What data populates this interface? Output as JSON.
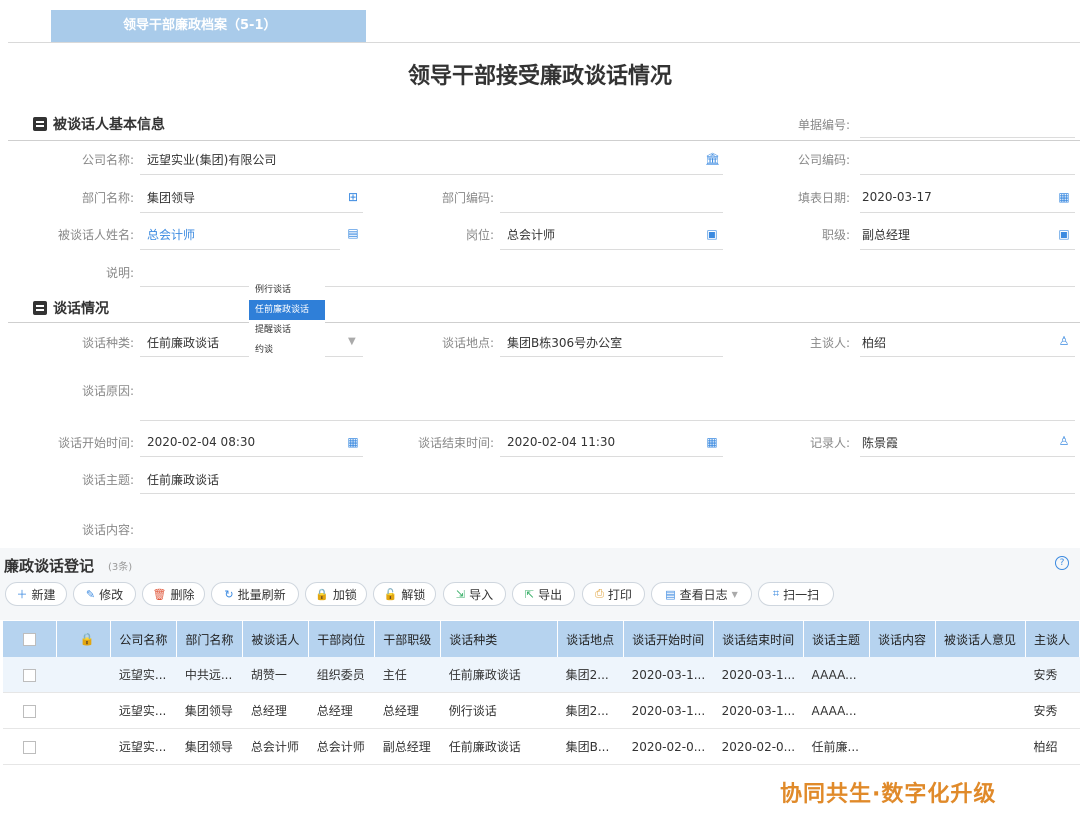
{
  "tab": {
    "label": "领导干部廉政档案（5-1）"
  },
  "page_title": "领导干部接受廉政谈话情况",
  "basic_section": {
    "title": "被谈话人基本信息"
  },
  "talk_section": {
    "title": "谈话情况"
  },
  "fields": {
    "doc_no_label": "单据编号:",
    "company_name_label": "公司名称:",
    "company_name_value": "远望实业(集团)有限公司",
    "company_code_label": "公司编码:",
    "dept_name_label": "部门名称:",
    "dept_name_value": "集团领导",
    "dept_code_label": "部门编码:",
    "fill_date_label": "填表日期:",
    "fill_date_value": "2020-03-17",
    "person_name_label": "被谈话人姓名:",
    "person_name_value": "总会计师",
    "post_label": "岗位:",
    "post_value": "总会计师",
    "rank_label": "职级:",
    "rank_value": "副总经理",
    "remark_label": "说明:",
    "talk_type_label": "谈话种类:",
    "talk_type_value": "任前廉政谈话",
    "talk_place_label": "谈话地点:",
    "talk_place_value": "集团B栋306号办公室",
    "host_label": "主谈人:",
    "host_value": "柏绍",
    "reason_label": "谈话原因:",
    "start_label": "谈话开始时间:",
    "start_value": "2020-02-04 08:30",
    "end_label": "谈话结束时间:",
    "end_value": "2020-02-04 11:30",
    "recorder_label": "记录人:",
    "recorder_value": "陈景霞",
    "subject_label": "谈话主题:",
    "subject_value": "任前廉政谈话",
    "content_label": "谈话内容:"
  },
  "dropdown": {
    "options": [
      "例行谈话",
      "任前廉政谈话",
      "提醒谈话",
      "约谈"
    ],
    "selected_index": 1
  },
  "grid": {
    "title": "廉政谈话登记",
    "count": "(3条)",
    "buttons": [
      "新建",
      "修改",
      "删除",
      "批量刷新",
      "加锁",
      "解锁",
      "导入",
      "导出",
      "打印",
      "查看日志",
      "扫一扫"
    ],
    "columns": [
      "公司名称",
      "部门名称",
      "被谈话人",
      "干部岗位",
      "干部职级",
      "谈话种类",
      "谈话地点",
      "谈话开始时间",
      "谈话结束时间",
      "谈话主题",
      "谈话内容",
      "被谈话人意见",
      "主谈人"
    ],
    "rows": [
      [
        "远望实...",
        "中共远...",
        "胡赞一",
        "组织委员",
        "主任",
        "任前廉政谈话",
        "集团2...",
        "2020-03-1...",
        "2020-03-1...",
        "AAAA...",
        "",
        "",
        "安秀"
      ],
      [
        "远望实...",
        "集团领导",
        "总经理",
        "总经理",
        "总经理",
        "例行谈话",
        "集团2...",
        "2020-03-1...",
        "2020-03-1...",
        "AAAA...",
        "",
        "",
        "安秀"
      ],
      [
        "远望实...",
        "集团领导",
        "总会计师",
        "总会计师",
        "副总经理",
        "任前廉政谈话",
        "集团B...",
        "2020-02-0...",
        "2020-02-0...",
        "任前廉...",
        "",
        "",
        "柏绍"
      ]
    ]
  },
  "watermark": "协同共生·数字化升级",
  "colors": {
    "accent": "#3b8ae0",
    "tab_bg": "#a9cbea",
    "header_bg": "#b6d3ef",
    "selected": "#2f7fd8",
    "watermark": "#e08a2a"
  }
}
